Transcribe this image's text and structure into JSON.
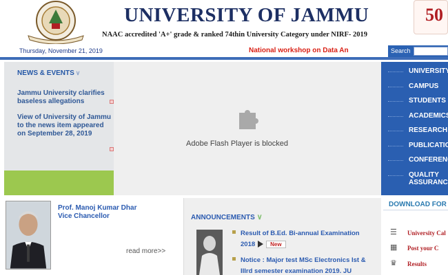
{
  "header": {
    "title": "UNIVERSITY OF JAMMU",
    "naac_prefix": "NAAC accredited 'A+' grade & ranked ",
    "naac_rank": "74th",
    "naac_suffix": "in University Category under NIRF- 2019",
    "badge_text": "50"
  },
  "infobar": {
    "date": "Thursday, November 21, 2019",
    "ticker": "National workshop on Data An",
    "search_label": "Search",
    "search_value": ""
  },
  "news": {
    "heading": "NEWS & EVENTS",
    "items": [
      "Jammu University clarifies baseless allegations",
      "View of University of Jammu to the news item appeared on September 28, 2019"
    ]
  },
  "flash": {
    "message": "Adobe Flash Player is blocked"
  },
  "nav": {
    "items": [
      "UNIVERSITY",
      "CAMPUS",
      "STUDENTS",
      "ACADEMICS",
      "RESEARCH",
      "PUBLICATIO",
      "CONFERENC",
      "QUALITY",
      "ASSURANC"
    ]
  },
  "vc": {
    "name": "Prof. Manoj Kumar Dhar",
    "role": "Vice Chancellor",
    "read_more": "read more>>"
  },
  "announcements": {
    "heading": "ANNOUNCEMENTS",
    "items": [
      {
        "line1": "Result of B.Ed. Bi-annual Examination",
        "line2": "2018",
        "badge": "New"
      },
      {
        "line1": "Notice : Major test MSc Electronics Ist &",
        "line2": "IIIrd semester examination 2019. JU",
        "badge": ""
      }
    ]
  },
  "downloads": {
    "heading": "DOWNLOAD FOR",
    "items": [
      {
        "label": "University Cal",
        "icon": "book-icon"
      },
      {
        "label": "Post your C",
        "icon": "calendar-icon"
      },
      {
        "label": "Results",
        "icon": "building-icon"
      }
    ]
  },
  "colors": {
    "title": "#1d2f63",
    "nav_bg": "#2a5fb1",
    "ticker": "#d91f14",
    "news_green": "#9cc84f",
    "link": "#2a5ab0"
  }
}
